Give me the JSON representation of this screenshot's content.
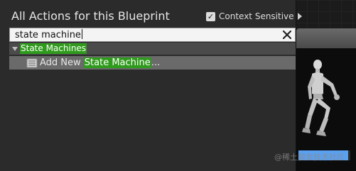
{
  "popup": {
    "title": "All Actions for this Blueprint",
    "context_sensitive": {
      "label": "Context Sensitive",
      "checked": true
    }
  },
  "search": {
    "value": "state machine"
  },
  "results": {
    "category": "State Machines",
    "action": {
      "prefix": "Add New ",
      "highlight": "State Machine",
      "suffix": "..."
    }
  },
  "preview": {
    "progress_fraction": 0.96
  },
  "watermark": "@稀土掘金技术社区",
  "colors": {
    "panel_bg": "#2b2b2b",
    "search_bg": "#f4f4f4",
    "category_bg": "#4b4b4b",
    "selected_row_bg": "#6a6a6a",
    "match_highlight": "#2f9b1c",
    "progress": "#5aa0f0"
  },
  "icons": {
    "checkbox": "checkmark-icon",
    "clear": "close-icon",
    "category_toggle": "triangle-down-icon",
    "action": "state-machine-icon",
    "context_arrow": "triangle-right-icon"
  }
}
